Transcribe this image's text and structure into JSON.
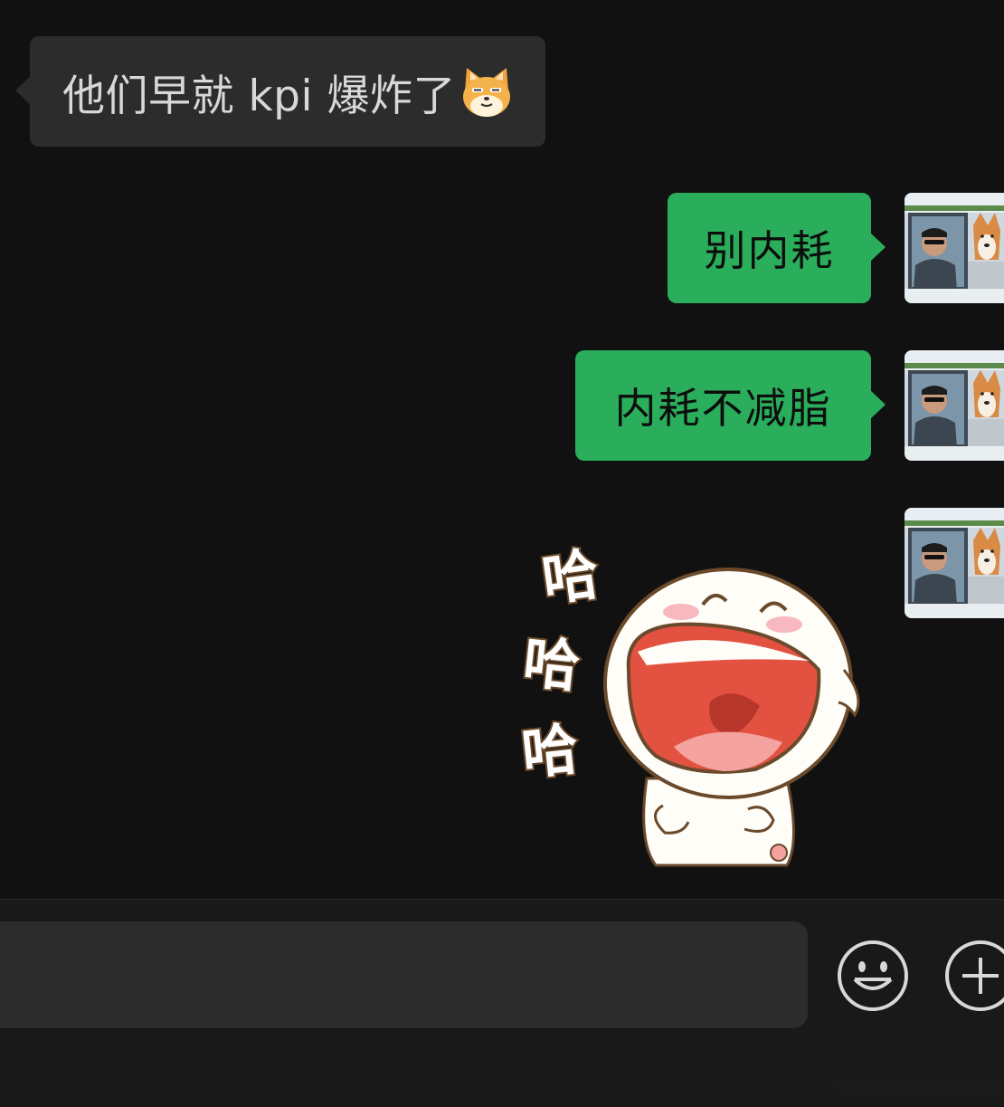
{
  "messages": {
    "incoming_1": {
      "text": "他们早就 kpi 爆炸了",
      "emoji": "cat-face-emoji"
    },
    "outgoing_1": {
      "text": "别内耗"
    },
    "outgoing_2": {
      "text": "内耗不减脂"
    },
    "outgoing_3": {
      "sticker": "laughing-cartoon-sticker",
      "sticker_text": [
        "哈",
        "哈",
        "哈"
      ]
    }
  },
  "input": {
    "value": "",
    "placeholder": ""
  },
  "icons": {
    "emoji_button": "smiley-face-icon",
    "more_button": "plus-icon"
  },
  "colors": {
    "background": "#111111",
    "incoming_bubble": "#2c2c2c",
    "outgoing_bubble": "#2aae5c",
    "input_bar": "#191919"
  }
}
